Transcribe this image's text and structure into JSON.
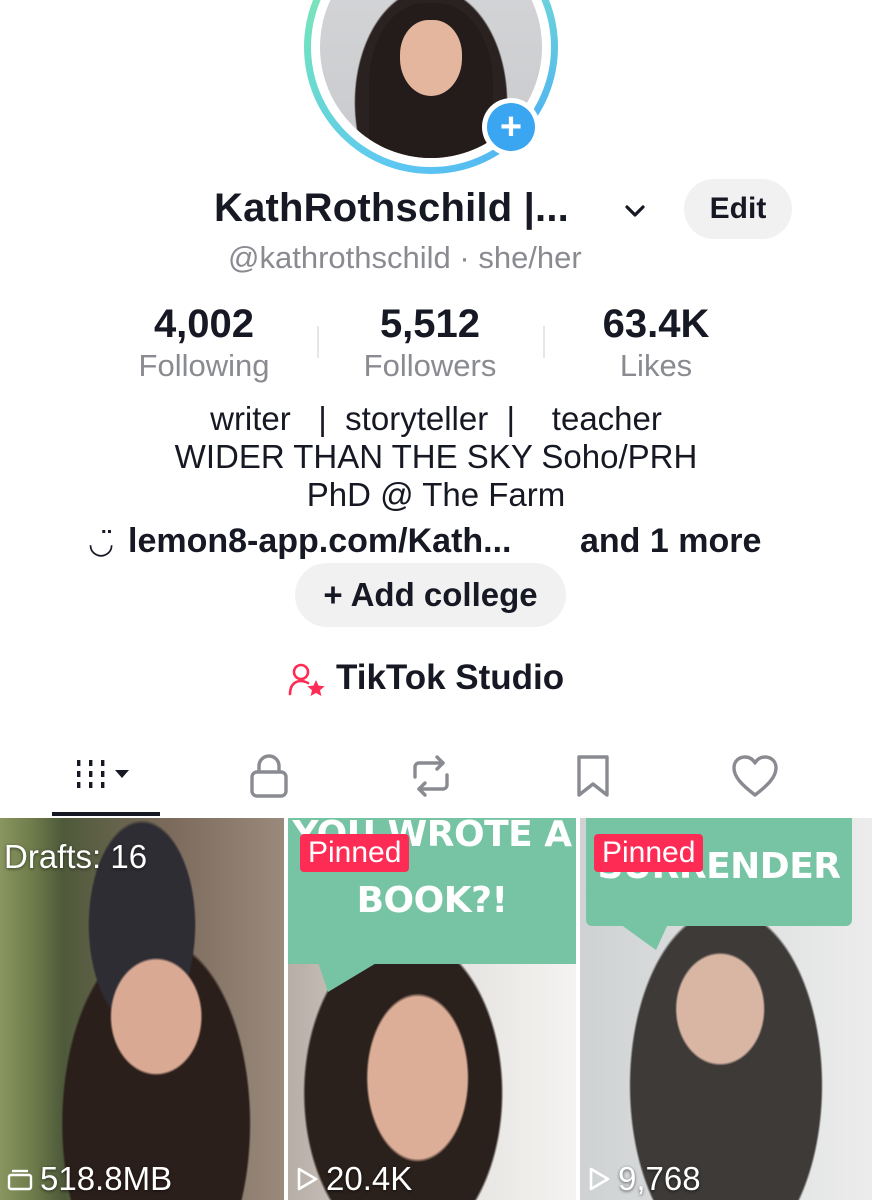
{
  "profile": {
    "display_name": "KathRothschild |...",
    "handle": "@kathrothschild",
    "pronouns_sep": "·",
    "pronouns": "she/her",
    "edit_label": "Edit"
  },
  "stats": [
    {
      "value": "4,002",
      "label": "Following"
    },
    {
      "value": "5,512",
      "label": "Followers"
    },
    {
      "value": "63.4K",
      "label": "Likes"
    }
  ],
  "bio": {
    "line1": "writer   |  storyteller  |    teacher",
    "line2": "WIDER THAN THE SKY Soho/PRH",
    "line3": "PhD @ The Farm"
  },
  "link": {
    "icon": "◡̈",
    "url": "lemon8-app.com/Kath...",
    "more": "and 1 more"
  },
  "college_button": "+ Add college",
  "studio_label": "TikTok Studio",
  "tabs": [
    {
      "icon": "grid-icon",
      "active": true
    },
    {
      "icon": "lock-icon",
      "active": false
    },
    {
      "icon": "repost-icon",
      "active": false
    },
    {
      "icon": "bookmark-icon",
      "active": false
    },
    {
      "icon": "heart-icon",
      "active": false
    }
  ],
  "videos": [
    {
      "overlay": "Drafts: 16",
      "meta": "518.8MB",
      "meta_icon": "storage-icon"
    },
    {
      "badge": "Pinned",
      "caption_line1": "YOU WROTE A",
      "caption_line2": "BOOK?!",
      "meta": "20.4K",
      "meta_icon": "play-icon"
    },
    {
      "badge": "Pinned",
      "caption_line1": "SURRENDER",
      "meta": "9,768",
      "meta_icon": "play-icon"
    }
  ],
  "colors": {
    "accent_red": "#fe2c55",
    "caption_green": "#76c4a4",
    "avatar_plus": "#3aa6f2"
  }
}
